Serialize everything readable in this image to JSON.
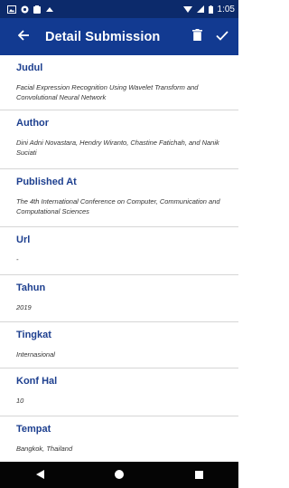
{
  "status_bar": {
    "time": "1:05",
    "left_icons": [
      "gallery-icon",
      "circle-notification-icon",
      "clipboard-icon",
      "cloud-icon"
    ],
    "right_icons": [
      "wifi-icon",
      "signal-icon",
      "battery-icon"
    ]
  },
  "app_bar": {
    "title": "Detail Submission",
    "back_icon": "arrow-left-icon",
    "delete_icon": "trash-icon",
    "confirm_icon": "checkmark-icon"
  },
  "fields": [
    {
      "label": "Judul",
      "value": "Facial Expression Recognition Using Wavelet Transform and Convolutional Neural Network"
    },
    {
      "label": "Author",
      "value": "Dini Adni Novastara, Hendry Wiranto, Chastine Fatichah, and Nanik Suciati"
    },
    {
      "label": "Published At",
      "value": "The 4th International Conference on Computer, Communication and Computational Sciences"
    },
    {
      "label": "Url",
      "value": "-"
    },
    {
      "label": "Tahun",
      "value": "2019"
    },
    {
      "label": "Tingkat",
      "value": "Internasional"
    },
    {
      "label": "Konf Hal",
      "value": "10"
    },
    {
      "label": "Tempat",
      "value": "Bangkok, Thailand"
    }
  ],
  "nav_bar": {
    "back_icon": "triangle-back-icon",
    "home_icon": "circle-home-icon",
    "recents_icon": "square-recents-icon"
  },
  "colors": {
    "status_bar": "#0c2a6b",
    "app_bar": "#123a91",
    "label": "#1d3f8f",
    "divider": "#d6d6d6",
    "nav_bar": "#050505"
  }
}
